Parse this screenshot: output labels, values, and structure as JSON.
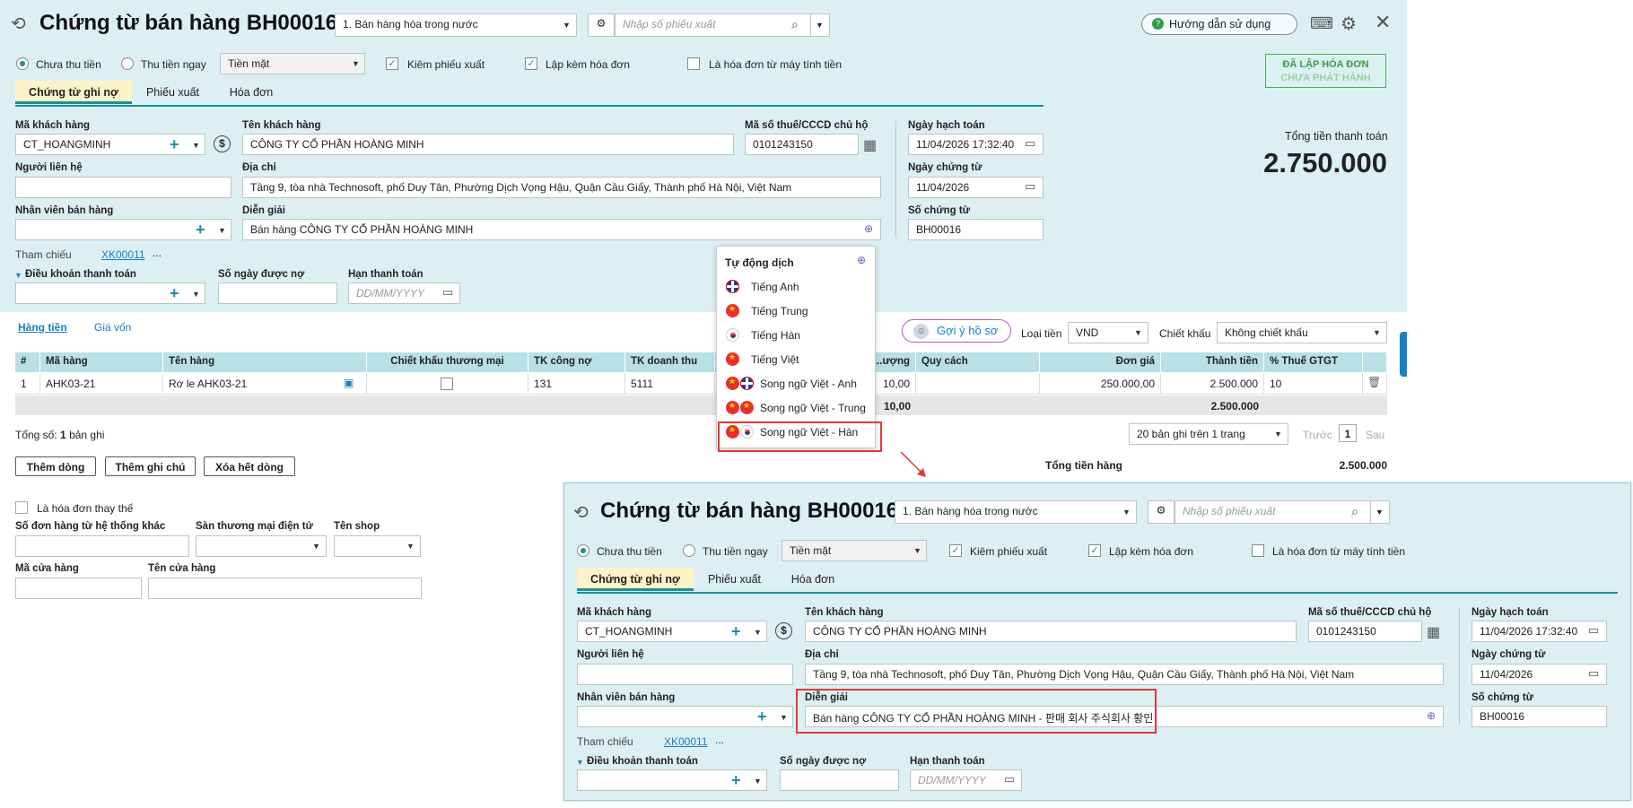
{
  "title": "Chứng từ bán hàng BH00016",
  "sale_type": "1. Bán hàng hóa trong nước",
  "slip_placeholder": "Nhập số phiếu xuất",
  "help": "Hướng dẫn sử dụng",
  "radio_unpaid": "Chưa thu tiền",
  "radio_paid": "Thu tiền ngay",
  "pay_method": "Tiền mặt",
  "chk_export": "Kiêm phiếu xuất",
  "chk_invoice": "Lập kèm hóa đơn",
  "chk_cash": "Là hóa đơn từ máy tính tiền",
  "badge_line1": "ĐÃ LẬP HÓA ĐƠN",
  "badge_line2": "CHƯA PHÁT HÀNH",
  "tabs": [
    "Chứng từ ghi nợ",
    "Phiếu xuất",
    "Hóa đơn"
  ],
  "lbl_cust_code": "Mã khách hàng",
  "cust_code": "CT_HOANGMINH",
  "lbl_cust_name": "Tên khách hàng",
  "cust_name": "CÔNG TY CỔ PHẦN HOÀNG MINH",
  "lbl_tax": "Mã số thuế/CCCD chủ hộ",
  "tax": "0101243150",
  "lbl_acc_date": "Ngày hạch toán",
  "acc_date": "11/04/2026 17:32:40",
  "lbl_contact": "Người liên hệ",
  "lbl_address": "Địa chỉ",
  "address": "Tầng 9, tòa nhà Technosoft, phố Duy Tân, Phường Dịch Vọng Hậu, Quận Cầu Giấy, Thành phố Hà Nội, Việt Nam",
  "lbl_doc_date": "Ngày chứng từ",
  "doc_date": "11/04/2026",
  "lbl_staff": "Nhân viên bán hàng",
  "lbl_desc": "Diễn giải",
  "desc": "Bán hàng CÔNG TY CỔ PHẦN HOÀNG MINH",
  "desc2": "Bán hàng CÔNG TY CỔ PHẦN HOÀNG MINH - 판매 회사 주식회사 황민",
  "lbl_doc_no": "Số chứng từ",
  "doc_no": "BH00016",
  "lbl_ref": "Tham chiếu",
  "ref": "XK00011",
  "ref_more": "...",
  "lbl_terms": "Điều khoản thanh toán",
  "lbl_days": "Số ngày được nợ",
  "lbl_due": "Hạn thanh toán",
  "due_ph": "DD/MM/YYYY",
  "lbl_total": "Tổng tiền thanh toán",
  "total": "2.750.000",
  "menu_title": "Tự động dịch",
  "menu": [
    "Tiếng Anh",
    "Tiếng Trung",
    "Tiếng Hàn",
    "Tiếng Việt",
    "Song ngữ Việt - Anh",
    "Song ngữ Việt - Trung",
    "Song ngữ Việt - Hàn"
  ],
  "sub_tabs": [
    "Hàng tiền",
    "Giá vốn"
  ],
  "suggest": "Gợi ý hồ sơ",
  "lbl_currency": "Loại tiền",
  "currency": "VND",
  "lbl_discount": "Chiết khấu",
  "discount": "Không chiết khấu",
  "cols": [
    "#",
    "Mã hàng",
    "Tên hàng",
    "Chiết khấu thương mại",
    "TK công nợ",
    "TK doanh thu",
    "...ượng",
    "Quy cách",
    "Đơn giá",
    "Thành tiền",
    "% Thuế GTGT"
  ],
  "row": [
    "1",
    "AHK03-21",
    "Rơ le AHK03-21",
    "",
    "131",
    "5111",
    "10,00",
    "",
    "250.000,00",
    "2.500.000",
    "10"
  ],
  "sum_qty": "10,00",
  "sum_amount": "2.500.000",
  "count_label": "Tổng số:",
  "count": "1",
  "count_unit": "bản ghi",
  "paging": "20 bản ghi trên 1 trang",
  "prev": "Trước",
  "page": "1",
  "next": "Sau",
  "btn_add_row": "Thêm dòng",
  "btn_add_note": "Thêm ghi chú",
  "btn_del_all": "Xóa hết dòng",
  "lbl_goods_total": "Tổng tiền hàng",
  "goods_total": "2.500.000",
  "chk_replace": "Là hóa đơn thay thế",
  "lbl_other_order": "Số đơn hàng từ hệ thống khác",
  "lbl_marketplace": "Sàn thương mại điện tử",
  "lbl_shop": "Tên shop",
  "lbl_store_code": "Mã cửa hàng",
  "lbl_store_name": "Tên cửa hàng"
}
